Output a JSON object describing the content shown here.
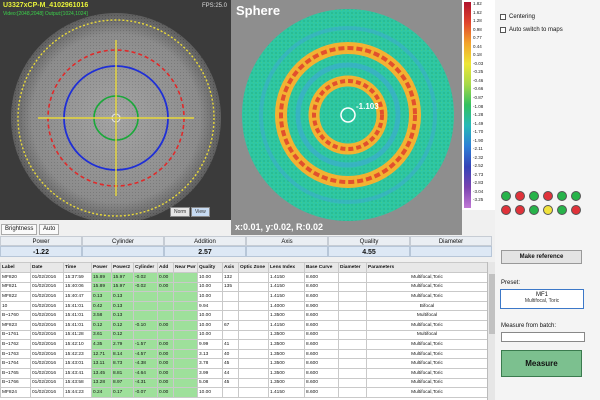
{
  "camera": {
    "title": "U3327xCP-M_4102961016",
    "subtitle": "Video:[2048,2048] Output:[1024,1024]",
    "fps": "FPS:25.0",
    "norm_label": "Norm",
    "view_label": "View"
  },
  "map": {
    "title": "Sphere",
    "center_value": "-1.103",
    "coord_text": "x:0.01, y:0.02, R:0.02"
  },
  "scale": {
    "labels": [
      "1.82",
      "1.62",
      "1.28",
      "0.98",
      "0.77",
      "0.44",
      "0.18",
      "-0.03",
      "-0.25",
      "-0.46",
      "-0.66",
      "-0.87",
      "-1.08",
      "-1.28",
      "-1.49",
      "-1.70",
      "-1.90",
      "-2.11",
      "-2.32",
      "-2.52",
      "-2.73",
      "-2.83",
      "-3.04",
      "-3.25"
    ]
  },
  "tabs": {
    "brightness": "Brightness",
    "auto": "Auto"
  },
  "summary": [
    {
      "label": "Power",
      "value": "-1.22"
    },
    {
      "label": "Cylinder",
      "value": ""
    },
    {
      "label": "Addition",
      "value": "2.57"
    },
    {
      "label": "Axis",
      "value": ""
    },
    {
      "label": "Quality",
      "value": "4.55"
    },
    {
      "label": "Diameter",
      "value": ""
    }
  ],
  "right": {
    "centering": "Centering",
    "auto_switch": "Auto switch to maps",
    "indicators": [
      "#27b34a",
      "#e0323a",
      "#27b34a",
      "#e0323a",
      "#27b34a",
      "#27b34a",
      "#e0323a",
      "#e0323a",
      "#27b34a",
      "#f0e23c",
      "#27b34a",
      "#e0323a"
    ],
    "make_reference": "Make reference",
    "preset_label": "Preset:",
    "preset_name": "MF1",
    "preset_desc": "Multifocal, Toric",
    "batch_label": "Measure from batch:",
    "measure": "Measure"
  },
  "table": {
    "headers": [
      "Label",
      "Date",
      "Time",
      "Power",
      "Power2",
      "Cylinder",
      "Add",
      "Near Pwr",
      "Quality",
      "Axis",
      "Optic Zone",
      "Lens Index",
      "Base Curve",
      "Diameter",
      "Parameters"
    ],
    "rows": [
      [
        "MF820",
        "01/02/2016",
        "15:37:59",
        "15.89",
        "15.97",
        "-0.02",
        "0.00",
        "",
        "10.00",
        "132",
        "",
        "1.4150",
        "8.600",
        "",
        "Multifocal,Toric"
      ],
      [
        "MF821",
        "01/02/2016",
        "15:40:06",
        "15.89",
        "15.97",
        "-0.02",
        "0.00",
        "",
        "10.00",
        "135",
        "",
        "1.4150",
        "8.600",
        "",
        "Multifocal,Toric"
      ],
      [
        "MF822",
        "01/02/2016",
        "15:40:47",
        "0.13",
        "0.13",
        "",
        "",
        "",
        "10.00",
        "",
        "",
        "1.4150",
        "8.600",
        "",
        "Multifocal,Toric"
      ],
      [
        "10",
        "01/02/2016",
        "15:41:01",
        "0.42",
        "0.13",
        "",
        "",
        "",
        "9.94",
        "",
        "",
        "1.4000",
        "8.900",
        "",
        "Bifocal"
      ],
      [
        "B~1760",
        "01/02/2016",
        "15:41:01",
        "3.58",
        "0.13",
        "",
        "",
        "",
        "10.00",
        "",
        "",
        "1.3500",
        "8.600",
        "",
        "Multifocal"
      ],
      [
        "MF823",
        "01/02/2016",
        "15:41:01",
        "0.12",
        "0.12",
        "-0.10",
        "0.00",
        "",
        "10.00",
        "67",
        "",
        "1.4150",
        "8.600",
        "",
        "Multifocal,Toric"
      ],
      [
        "B~1761",
        "01/02/2016",
        "15:41:28",
        "3.61",
        "0.12",
        "",
        "",
        "",
        "10.00",
        "",
        "",
        "1.3500",
        "8.600",
        "",
        "Multifocal"
      ],
      [
        "B~1762",
        "01/02/2016",
        "15:42:10",
        "4.35",
        "2.79",
        "-1.57",
        "0.00",
        "",
        "9.99",
        "41",
        "",
        "1.3500",
        "8.600",
        "",
        "Multifocal,Toric"
      ],
      [
        "B~1763",
        "01/02/2016",
        "15:42:23",
        "12.71",
        "8.14",
        "-4.57",
        "0.00",
        "",
        "3.13",
        "40",
        "",
        "1.3500",
        "8.600",
        "",
        "Multifocal,Toric"
      ],
      [
        "B~1764",
        "01/02/2016",
        "15:43:01",
        "13.11",
        "8.73",
        "-4.38",
        "0.00",
        "",
        "3.78",
        "45",
        "",
        "1.3500",
        "8.600",
        "",
        "Multifocal,Toric"
      ],
      [
        "B~1765",
        "01/02/2016",
        "15:43:41",
        "13.45",
        "8.81",
        "-4.64",
        "0.00",
        "",
        "3.99",
        "44",
        "",
        "1.3500",
        "8.600",
        "",
        "Multifocal,Toric"
      ],
      [
        "B~1766",
        "01/02/2016",
        "15:43:58",
        "13.28",
        "8.97",
        "-4.31",
        "0.00",
        "",
        "5.08",
        "45",
        "",
        "1.3500",
        "8.600",
        "",
        "Multifocal,Toric"
      ],
      [
        "MF824",
        "01/02/2016",
        "15:44:23",
        "0.24",
        "0.17",
        "-0.07",
        "0.00",
        "",
        "10.00",
        "",
        "",
        "1.4150",
        "8.600",
        "",
        "Multifocal,Toric"
      ]
    ]
  }
}
